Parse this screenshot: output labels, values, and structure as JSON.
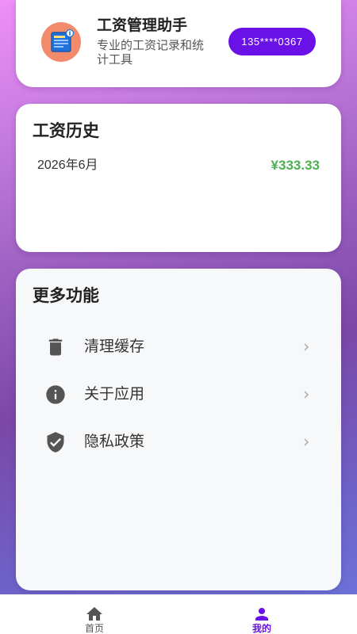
{
  "header": {
    "app_name": "工资管理助手",
    "subtitle": "专业的工资记录和统计工具",
    "account_button": "135****0367",
    "logo_icon": "salary-document-logo-icon"
  },
  "history": {
    "title": "工资历史",
    "records": [
      {
        "month": "2026年6月",
        "amount": "¥333.33"
      }
    ]
  },
  "more": {
    "title": "更多功能",
    "items": [
      {
        "label": "清理缓存",
        "icon": "trash-icon"
      },
      {
        "label": "关于应用",
        "icon": "info-icon"
      },
      {
        "label": "隐私政策",
        "icon": "shield-check-icon"
      }
    ]
  },
  "nav": {
    "items": [
      {
        "label": "首页",
        "icon": "home-icon",
        "active": false
      },
      {
        "label": "我的",
        "icon": "person-icon",
        "active": true
      }
    ]
  },
  "colors": {
    "accent": "#6a11e8",
    "amount_positive": "#4caf50",
    "logo_background": "#f28a6c",
    "icon_gray": "#555555",
    "chevron_gray": "#aaaaaa"
  }
}
